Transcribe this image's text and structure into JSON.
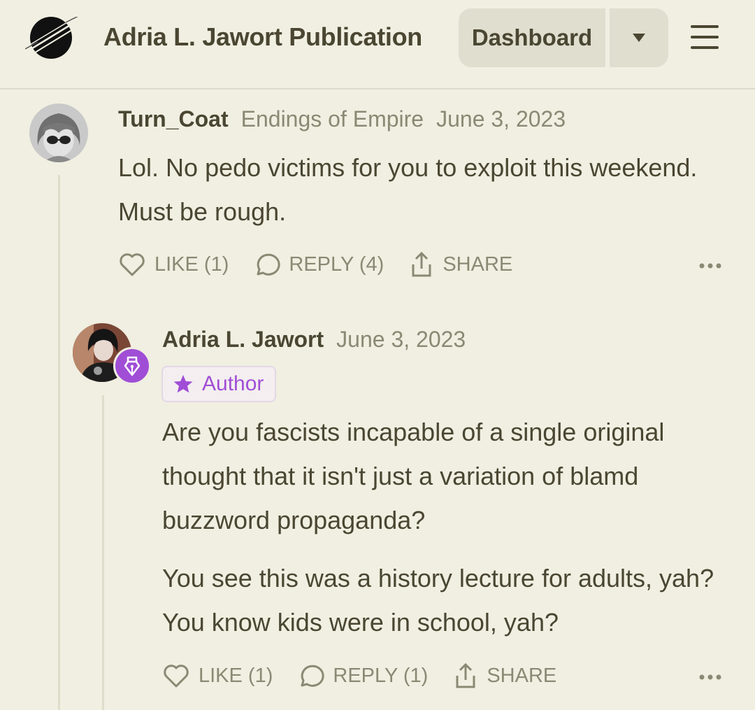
{
  "header": {
    "publication_title": "Adria L. Jawort Publication",
    "dashboard_label": "Dashboard"
  },
  "comments": [
    {
      "username": "Turn_Coat",
      "publication": "Endings of Empire",
      "date": "June 3, 2023",
      "paragraphs": [
        "Lol. No pedo victims for you to exploit this weekend. Must be rough."
      ],
      "like_label": "LIKE (1)",
      "reply_label": "REPLY (4)",
      "share_label": "SHARE"
    },
    {
      "username": "Adria L. Jawort",
      "date": "June 3, 2023",
      "badge": "Author",
      "paragraphs": [
        "Are you fascists incapable of a single original thought that it isn't just a variation of blamd buzzword propaganda?",
        "You see this was a history lecture for adults, yah? You know kids were in school, yah?"
      ],
      "like_label": "LIKE (1)",
      "reply_label": "REPLY (1)",
      "share_label": "SHARE"
    }
  ],
  "colors": {
    "background": "#f0efe1",
    "text": "#4a4632",
    "muted": "#8b8874",
    "author_accent": "#a04ed6"
  },
  "icons": [
    "publication-logo-icon",
    "chevron-down-icon",
    "hamburger-menu-icon",
    "heart-icon",
    "comment-bubble-icon",
    "share-icon",
    "more-dots-icon",
    "pen-nib-icon",
    "star-icon"
  ]
}
